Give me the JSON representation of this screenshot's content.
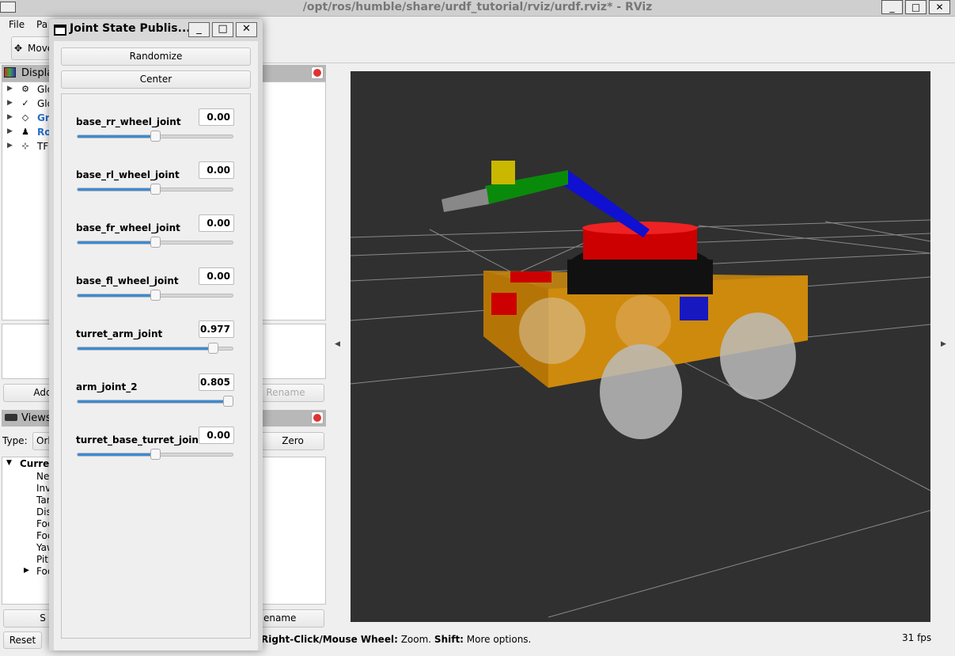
{
  "window": {
    "title": "/opt/ros/humble/share/urdf_tutorial/rviz/urdf.rviz* - RViz",
    "min": "_",
    "max": "□",
    "close": "✕"
  },
  "menu": [
    "File",
    "Pa"
  ],
  "toolbar": {
    "move": "Move"
  },
  "displays": {
    "title": "Displa",
    "items": [
      {
        "label": "Glo",
        "color": "#000"
      },
      {
        "label": "Glo",
        "color": "#000"
      },
      {
        "label": "Gr",
        "color": "#2a6fc9"
      },
      {
        "label": "Ro",
        "color": "#2a6fc9"
      },
      {
        "label": "TF",
        "color": "#000"
      }
    ],
    "add": "Add",
    "rename": "Rename"
  },
  "views": {
    "title": "Views",
    "type_label": "Type:",
    "type_value": "Orl",
    "zero": "Zero",
    "current": "Curre",
    "props": [
      "Ne",
      "Inv",
      "Tar",
      "Dis",
      "Foc",
      "Foc",
      "Yaw",
      "Pit",
      "Foc"
    ],
    "save": "S",
    "rename": "ename"
  },
  "status": {
    "reset": "Reset",
    "hint_bold1": "Right-Click/Mouse Wheel:",
    "hint1": " Zoom. ",
    "hint_bold2": "Shift:",
    "hint2": " More options.",
    "fps": "31 fps"
  },
  "dialog": {
    "title": "Joint State Publis...",
    "min": "_",
    "max": "□",
    "close": "✕",
    "randomize": "Randomize",
    "center": "Center",
    "joints": [
      {
        "name": "base_rr_wheel_joint",
        "value": "0.00",
        "fraction": 0.5
      },
      {
        "name": "base_rl_wheel_joint",
        "value": "0.00",
        "fraction": 0.5
      },
      {
        "name": "base_fr_wheel_joint",
        "value": "0.00",
        "fraction": 0.5
      },
      {
        "name": "base_fl_wheel_joint",
        "value": "0.00",
        "fraction": 0.5
      },
      {
        "name": "turret_arm_joint",
        "value": "0.977",
        "fraction": 0.87
      },
      {
        "name": "arm_joint_2",
        "value": "0.805",
        "fraction": 0.97
      },
      {
        "name": "turret_base_turret_joint",
        "value": "0.00",
        "fraction": 0.5
      }
    ]
  }
}
